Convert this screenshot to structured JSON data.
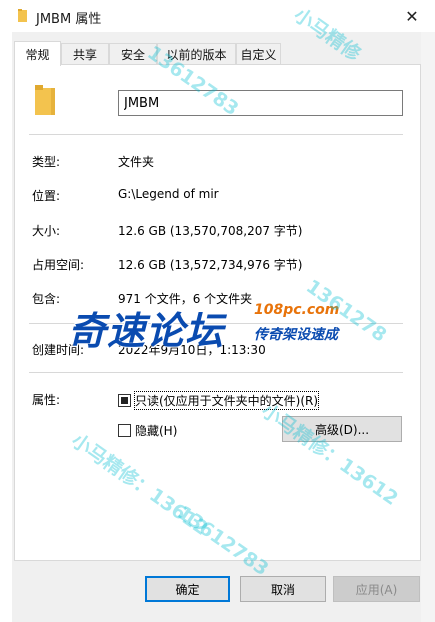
{
  "window": {
    "title": "JMBM 属性",
    "close_glyph": "✕"
  },
  "tabs": [
    {
      "label": "常规",
      "active": true
    },
    {
      "label": "共享",
      "active": false
    },
    {
      "label": "安全",
      "active": false
    },
    {
      "label": "以前的版本",
      "active": false
    },
    {
      "label": "自定义",
      "active": false
    }
  ],
  "general": {
    "folder_name": "JMBM",
    "type_label": "类型:",
    "type_value": "文件夹",
    "location_label": "位置:",
    "location_value": "G:\\Legend of mir",
    "size_label": "大小:",
    "size_value": "12.6 GB (13,570,708,207 字节)",
    "size_on_disk_label": "占用空间:",
    "size_on_disk_value": "12.6 GB (13,572,734,976 字节)",
    "contains_label": "包含:",
    "contains_value": "971 个文件，6 个文件夹",
    "created_label": "创建时间:",
    "created_value": "2022年9月10日，1:13:30",
    "attributes_label": "属性:",
    "readonly_label": "只读(仅应用于文件夹中的文件)(R)",
    "readonly_checked": true,
    "hidden_label": "隐藏(H)",
    "hidden_checked": false,
    "advanced_label": "高级(D)..."
  },
  "buttons": {
    "ok": "确定",
    "cancel": "取消",
    "apply": "应用(A)"
  },
  "watermark": {
    "logo_text": "奇速论坛",
    "site": "108pc.com",
    "slogan": "传奇架设速成",
    "text_1": "小马精修：13612",
    "text_2": "小马精修：13612",
    "text_3": "1361278",
    "text_4": "13612783",
    "text_5": "小马精修",
    "text_6": "13612783",
    "colors": {
      "logo": "#0a4bb0",
      "site": "#e8730a",
      "watermark": "#00bed2"
    }
  }
}
